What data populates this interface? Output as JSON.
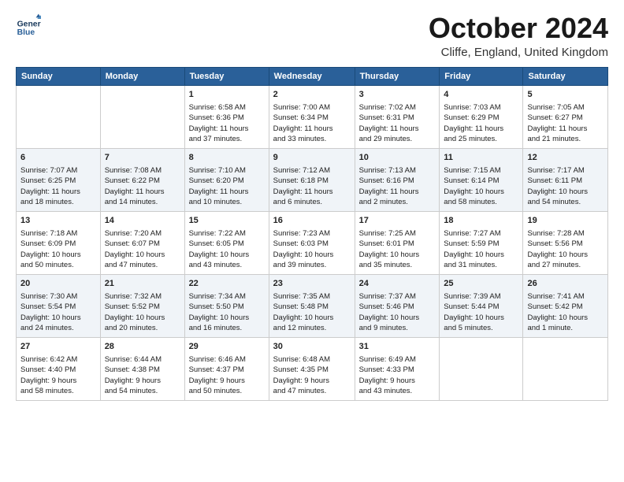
{
  "header": {
    "logo_line1": "General",
    "logo_line2": "Blue",
    "month_title": "October 2024",
    "subtitle": "Cliffe, England, United Kingdom"
  },
  "days_of_week": [
    "Sunday",
    "Monday",
    "Tuesday",
    "Wednesday",
    "Thursday",
    "Friday",
    "Saturday"
  ],
  "weeks": [
    [
      {
        "day": "",
        "content": ""
      },
      {
        "day": "",
        "content": ""
      },
      {
        "day": "1",
        "content": "Sunrise: 6:58 AM\nSunset: 6:36 PM\nDaylight: 11 hours\nand 37 minutes."
      },
      {
        "day": "2",
        "content": "Sunrise: 7:00 AM\nSunset: 6:34 PM\nDaylight: 11 hours\nand 33 minutes."
      },
      {
        "day": "3",
        "content": "Sunrise: 7:02 AM\nSunset: 6:31 PM\nDaylight: 11 hours\nand 29 minutes."
      },
      {
        "day": "4",
        "content": "Sunrise: 7:03 AM\nSunset: 6:29 PM\nDaylight: 11 hours\nand 25 minutes."
      },
      {
        "day": "5",
        "content": "Sunrise: 7:05 AM\nSunset: 6:27 PM\nDaylight: 11 hours\nand 21 minutes."
      }
    ],
    [
      {
        "day": "6",
        "content": "Sunrise: 7:07 AM\nSunset: 6:25 PM\nDaylight: 11 hours\nand 18 minutes."
      },
      {
        "day": "7",
        "content": "Sunrise: 7:08 AM\nSunset: 6:22 PM\nDaylight: 11 hours\nand 14 minutes."
      },
      {
        "day": "8",
        "content": "Sunrise: 7:10 AM\nSunset: 6:20 PM\nDaylight: 11 hours\nand 10 minutes."
      },
      {
        "day": "9",
        "content": "Sunrise: 7:12 AM\nSunset: 6:18 PM\nDaylight: 11 hours\nand 6 minutes."
      },
      {
        "day": "10",
        "content": "Sunrise: 7:13 AM\nSunset: 6:16 PM\nDaylight: 11 hours\nand 2 minutes."
      },
      {
        "day": "11",
        "content": "Sunrise: 7:15 AM\nSunset: 6:14 PM\nDaylight: 10 hours\nand 58 minutes."
      },
      {
        "day": "12",
        "content": "Sunrise: 7:17 AM\nSunset: 6:11 PM\nDaylight: 10 hours\nand 54 minutes."
      }
    ],
    [
      {
        "day": "13",
        "content": "Sunrise: 7:18 AM\nSunset: 6:09 PM\nDaylight: 10 hours\nand 50 minutes."
      },
      {
        "day": "14",
        "content": "Sunrise: 7:20 AM\nSunset: 6:07 PM\nDaylight: 10 hours\nand 47 minutes."
      },
      {
        "day": "15",
        "content": "Sunrise: 7:22 AM\nSunset: 6:05 PM\nDaylight: 10 hours\nand 43 minutes."
      },
      {
        "day": "16",
        "content": "Sunrise: 7:23 AM\nSunset: 6:03 PM\nDaylight: 10 hours\nand 39 minutes."
      },
      {
        "day": "17",
        "content": "Sunrise: 7:25 AM\nSunset: 6:01 PM\nDaylight: 10 hours\nand 35 minutes."
      },
      {
        "day": "18",
        "content": "Sunrise: 7:27 AM\nSunset: 5:59 PM\nDaylight: 10 hours\nand 31 minutes."
      },
      {
        "day": "19",
        "content": "Sunrise: 7:28 AM\nSunset: 5:56 PM\nDaylight: 10 hours\nand 27 minutes."
      }
    ],
    [
      {
        "day": "20",
        "content": "Sunrise: 7:30 AM\nSunset: 5:54 PM\nDaylight: 10 hours\nand 24 minutes."
      },
      {
        "day": "21",
        "content": "Sunrise: 7:32 AM\nSunset: 5:52 PM\nDaylight: 10 hours\nand 20 minutes."
      },
      {
        "day": "22",
        "content": "Sunrise: 7:34 AM\nSunset: 5:50 PM\nDaylight: 10 hours\nand 16 minutes."
      },
      {
        "day": "23",
        "content": "Sunrise: 7:35 AM\nSunset: 5:48 PM\nDaylight: 10 hours\nand 12 minutes."
      },
      {
        "day": "24",
        "content": "Sunrise: 7:37 AM\nSunset: 5:46 PM\nDaylight: 10 hours\nand 9 minutes."
      },
      {
        "day": "25",
        "content": "Sunrise: 7:39 AM\nSunset: 5:44 PM\nDaylight: 10 hours\nand 5 minutes."
      },
      {
        "day": "26",
        "content": "Sunrise: 7:41 AM\nSunset: 5:42 PM\nDaylight: 10 hours\nand 1 minute."
      }
    ],
    [
      {
        "day": "27",
        "content": "Sunrise: 6:42 AM\nSunset: 4:40 PM\nDaylight: 9 hours\nand 58 minutes."
      },
      {
        "day": "28",
        "content": "Sunrise: 6:44 AM\nSunset: 4:38 PM\nDaylight: 9 hours\nand 54 minutes."
      },
      {
        "day": "29",
        "content": "Sunrise: 6:46 AM\nSunset: 4:37 PM\nDaylight: 9 hours\nand 50 minutes."
      },
      {
        "day": "30",
        "content": "Sunrise: 6:48 AM\nSunset: 4:35 PM\nDaylight: 9 hours\nand 47 minutes."
      },
      {
        "day": "31",
        "content": "Sunrise: 6:49 AM\nSunset: 4:33 PM\nDaylight: 9 hours\nand 43 minutes."
      },
      {
        "day": "",
        "content": ""
      },
      {
        "day": "",
        "content": ""
      }
    ]
  ]
}
